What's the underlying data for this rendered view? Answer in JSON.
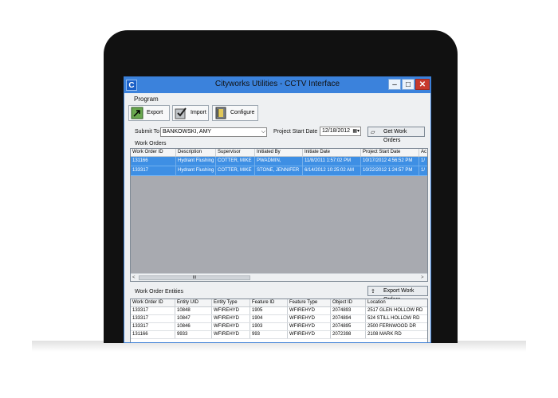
{
  "window": {
    "title": "Cityworks Utilities - CCTV Interface",
    "app_icon": "C"
  },
  "window_controls": {
    "minimize": "–",
    "maximize": "□",
    "close": "✕"
  },
  "menu": {
    "program": "Program"
  },
  "toolbar": {
    "export": "Export",
    "import": "Import",
    "configure": "Configure"
  },
  "form": {
    "submit_to_label": "Submit To",
    "submit_to_value": "BANKOWSKI, AMY",
    "project_start_label": "Project Start Date",
    "project_start_value": "12/18/2012",
    "get_work_orders": "Get Work Orders"
  },
  "work_orders": {
    "section_label": "Work Orders",
    "columns": [
      "Work Order ID",
      "Description",
      "Supervisor",
      "Initiated By",
      "Initiate Date",
      "Project Start Date",
      "Ac"
    ],
    "rows": [
      [
        "131166",
        "Hydrant Flushing",
        "COTTER, MIKE",
        "PWADMIN,",
        "11/8/2011 1:57:02 PM",
        "10/17/2012 4:56:52 PM",
        "1/"
      ],
      [
        "133317",
        "Hydrant Flushing",
        "COTTER, MIKE",
        "STONE, JENNIFER",
        "6/14/2012 10:25:02 AM",
        "10/22/2012 1:24:57 PM",
        "1/"
      ]
    ],
    "scroll_thumb": "III",
    "scroll_left": "<",
    "scroll_right": ">"
  },
  "entities": {
    "section_label": "Work Order Entities",
    "export_button": "Export Work Orders",
    "columns": [
      "Work Order ID",
      "Entity UID",
      "Entity Type",
      "Feature ID",
      "Feature Type",
      "Object ID",
      "Location"
    ],
    "rows": [
      [
        "133317",
        "10848",
        "WFIREHYD",
        "1905",
        "WFIREHYD",
        "2074893",
        "2517 GLEN HOLLOW RD"
      ],
      [
        "133317",
        "10847",
        "WFIREHYD",
        "1904",
        "WFIREHYD",
        "2074894",
        "524 STILL HOLLOW RD"
      ],
      [
        "133317",
        "10846",
        "WFIREHYD",
        "1903",
        "WFIREHYD",
        "2074895",
        "2500 FERNWOOD DR"
      ],
      [
        "131166",
        "9933",
        "WFIREHYD",
        "993",
        "WFIREHYD",
        "2072398",
        "2108 MARK RD"
      ]
    ]
  },
  "colors": {
    "title_bar": "#3b82dc",
    "selection": "#3e8fe4",
    "close_button": "#c8392c",
    "bezel": "#111111"
  },
  "icons": {
    "export": "export-icon",
    "import": "import-icon",
    "configure": "configure-icon",
    "dropdown": "chevron-down-icon",
    "calendar": "calendar-icon"
  }
}
